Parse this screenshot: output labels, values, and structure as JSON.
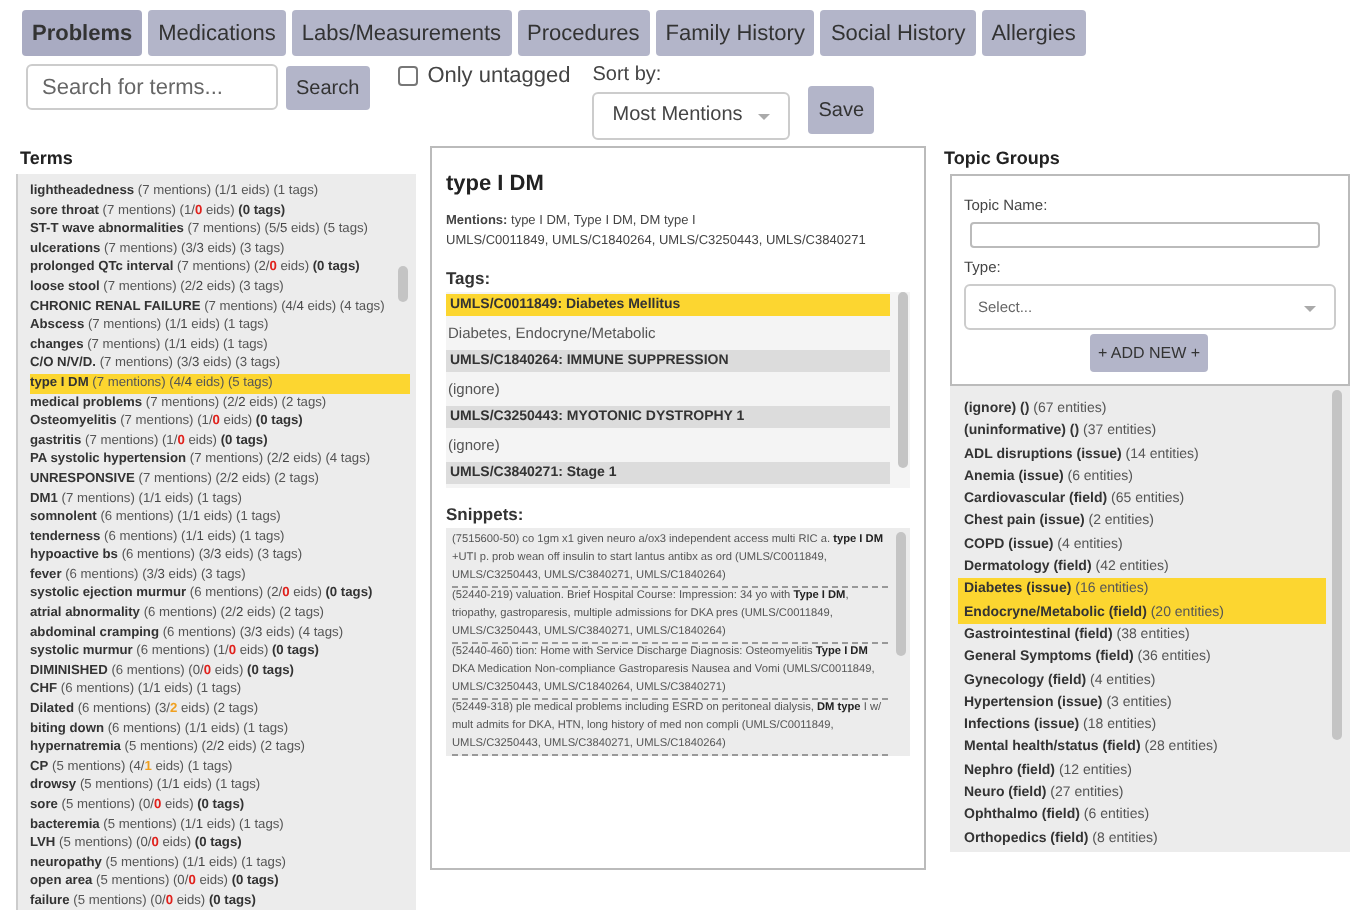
{
  "tabs": [
    {
      "label": "Problems",
      "selected": true
    },
    {
      "label": "Medications",
      "selected": false
    },
    {
      "label": "Labs/Measurements",
      "selected": false
    },
    {
      "label": "Procedures",
      "selected": false
    },
    {
      "label": "Family History",
      "selected": false
    },
    {
      "label": "Social History",
      "selected": false
    },
    {
      "label": "Allergies",
      "selected": false
    }
  ],
  "search": {
    "placeholder": "Search for terms...",
    "button": "Search"
  },
  "only_untagged": {
    "label": "Only untagged",
    "checked": false
  },
  "sort": {
    "label": "Sort by:",
    "value": "Most Mentions"
  },
  "save_button": "Save",
  "terms": {
    "heading": "Terms",
    "items": [
      {
        "name": "lightheadedness",
        "mentions": "(7 mentions)",
        "eids": [
          "(1/",
          "1",
          " eids)"
        ],
        "kind": "ok",
        "tags": "(1 tags)",
        "untagged": false,
        "selected": false
      },
      {
        "name": "sore throat",
        "mentions": "(7 mentions)",
        "eids": [
          "(1/",
          "0",
          " eids)"
        ],
        "kind": "none",
        "tags": "(0 tags)",
        "untagged": true,
        "selected": false
      },
      {
        "name": "ST-T wave abnormalities",
        "mentions": "(7 mentions)",
        "eids": [
          "(5/",
          "5",
          " eids)"
        ],
        "kind": "ok",
        "tags": "(5 tags)",
        "untagged": false,
        "selected": false
      },
      {
        "name": "ulcerations",
        "mentions": "(7 mentions)",
        "eids": [
          "(3/",
          "3",
          " eids)"
        ],
        "kind": "ok",
        "tags": "(3 tags)",
        "untagged": false,
        "selected": false
      },
      {
        "name": "prolonged QTc interval",
        "mentions": "(7 mentions)",
        "eids": [
          "(2/",
          "0",
          " eids)"
        ],
        "kind": "none",
        "tags": "(0 tags)",
        "untagged": true,
        "selected": false
      },
      {
        "name": "loose stool",
        "mentions": "(7 mentions)",
        "eids": [
          "(2/",
          "2",
          " eids)"
        ],
        "kind": "ok",
        "tags": "(3 tags)",
        "untagged": false,
        "selected": false
      },
      {
        "name": "CHRONIC RENAL FAILURE",
        "mentions": "(7 mentions)",
        "eids": [
          "(4/",
          "4",
          " eids)"
        ],
        "kind": "ok",
        "tags": "(4 tags)",
        "untagged": false,
        "selected": false
      },
      {
        "name": "Abscess",
        "mentions": "(7 mentions)",
        "eids": [
          "(1/",
          "1",
          " eids)"
        ],
        "kind": "ok",
        "tags": "(1 tags)",
        "untagged": false,
        "selected": false
      },
      {
        "name": "changes",
        "mentions": "(7 mentions)",
        "eids": [
          "(1/",
          "1",
          " eids)"
        ],
        "kind": "ok",
        "tags": "(1 tags)",
        "untagged": false,
        "selected": false
      },
      {
        "name": "C/O N/V/D.",
        "mentions": "(7 mentions)",
        "eids": [
          "(3/",
          "3",
          " eids)"
        ],
        "kind": "ok",
        "tags": "(3 tags)",
        "untagged": false,
        "selected": false
      },
      {
        "name": "type I DM",
        "mentions": "(7 mentions)",
        "eids": [
          "(4/",
          "4",
          " eids)"
        ],
        "kind": "ok",
        "tags": "(5 tags)",
        "untagged": false,
        "selected": true
      },
      {
        "name": "medical problems",
        "mentions": "(7 mentions)",
        "eids": [
          "(2/",
          "2",
          " eids)"
        ],
        "kind": "ok",
        "tags": "(2 tags)",
        "untagged": false,
        "selected": false
      },
      {
        "name": "Osteomyelitis",
        "mentions": "(7 mentions)",
        "eids": [
          "(1/",
          "0",
          " eids)"
        ],
        "kind": "none",
        "tags": "(0 tags)",
        "untagged": true,
        "selected": false
      },
      {
        "name": "gastritis",
        "mentions": "(7 mentions)",
        "eids": [
          "(1/",
          "0",
          " eids)"
        ],
        "kind": "none",
        "tags": "(0 tags)",
        "untagged": true,
        "selected": false
      },
      {
        "name": "PA systolic hypertension",
        "mentions": "(7 mentions)",
        "eids": [
          "(2/",
          "2",
          " eids)"
        ],
        "kind": "ok",
        "tags": "(4 tags)",
        "untagged": false,
        "selected": false
      },
      {
        "name": "UNRESPONSIVE",
        "mentions": "(7 mentions)",
        "eids": [
          "(2/",
          "2",
          " eids)"
        ],
        "kind": "ok",
        "tags": "(2 tags)",
        "untagged": false,
        "selected": false
      },
      {
        "name": "DM1",
        "mentions": "(7 mentions)",
        "eids": [
          "(1/",
          "1",
          " eids)"
        ],
        "kind": "ok",
        "tags": "(1 tags)",
        "untagged": false,
        "selected": false
      },
      {
        "name": "somnolent",
        "mentions": "(6 mentions)",
        "eids": [
          "(1/",
          "1",
          " eids)"
        ],
        "kind": "ok",
        "tags": "(1 tags)",
        "untagged": false,
        "selected": false
      },
      {
        "name": "tenderness",
        "mentions": "(6 mentions)",
        "eids": [
          "(1/",
          "1",
          " eids)"
        ],
        "kind": "ok",
        "tags": "(1 tags)",
        "untagged": false,
        "selected": false
      },
      {
        "name": "hypoactive bs",
        "mentions": "(6 mentions)",
        "eids": [
          "(3/",
          "3",
          " eids)"
        ],
        "kind": "ok",
        "tags": "(3 tags)",
        "untagged": false,
        "selected": false
      },
      {
        "name": "fever",
        "mentions": "(6 mentions)",
        "eids": [
          "(3/",
          "3",
          " eids)"
        ],
        "kind": "ok",
        "tags": "(3 tags)",
        "untagged": false,
        "selected": false
      },
      {
        "name": "systolic ejection murmur",
        "mentions": "(6 mentions)",
        "eids": [
          "(2/",
          "0",
          " eids)"
        ],
        "kind": "none",
        "tags": "(0 tags)",
        "untagged": true,
        "selected": false
      },
      {
        "name": "atrial abnormality",
        "mentions": "(6 mentions)",
        "eids": [
          "(2/",
          "2",
          " eids)"
        ],
        "kind": "ok",
        "tags": "(2 tags)",
        "untagged": false,
        "selected": false
      },
      {
        "name": "abdominal cramping",
        "mentions": "(6 mentions)",
        "eids": [
          "(3/",
          "3",
          " eids)"
        ],
        "kind": "ok",
        "tags": "(4 tags)",
        "untagged": false,
        "selected": false
      },
      {
        "name": "systolic murmur",
        "mentions": "(6 mentions)",
        "eids": [
          "(1/",
          "0",
          " eids)"
        ],
        "kind": "none",
        "tags": "(0 tags)",
        "untagged": true,
        "selected": false
      },
      {
        "name": "DIMINISHED",
        "mentions": "(6 mentions)",
        "eids": [
          "(0/",
          "0",
          " eids)"
        ],
        "kind": "none",
        "tags": "(0 tags)",
        "untagged": true,
        "selected": false
      },
      {
        "name": "CHF",
        "mentions": "(6 mentions)",
        "eids": [
          "(1/",
          "1",
          " eids)"
        ],
        "kind": "ok",
        "tags": "(1 tags)",
        "untagged": false,
        "selected": false
      },
      {
        "name": "Dilated",
        "mentions": "(6 mentions)",
        "eids": [
          "(3/",
          "2",
          " eids)"
        ],
        "kind": "partial",
        "tags": "(2 tags)",
        "untagged": false,
        "selected": false
      },
      {
        "name": "biting down",
        "mentions": "(6 mentions)",
        "eids": [
          "(1/",
          "1",
          " eids)"
        ],
        "kind": "ok",
        "tags": "(1 tags)",
        "untagged": false,
        "selected": false
      },
      {
        "name": "hypernatremia",
        "mentions": "(5 mentions)",
        "eids": [
          "(2/",
          "2",
          " eids)"
        ],
        "kind": "ok",
        "tags": "(2 tags)",
        "untagged": false,
        "selected": false
      },
      {
        "name": "CP",
        "mentions": "(5 mentions)",
        "eids": [
          "(4/",
          "1",
          " eids)"
        ],
        "kind": "partial",
        "tags": "(1 tags)",
        "untagged": false,
        "selected": false
      },
      {
        "name": "drowsy",
        "mentions": "(5 mentions)",
        "eids": [
          "(1/",
          "1",
          " eids)"
        ],
        "kind": "ok",
        "tags": "(1 tags)",
        "untagged": false,
        "selected": false
      },
      {
        "name": "sore",
        "mentions": "(5 mentions)",
        "eids": [
          "(0/",
          "0",
          " eids)"
        ],
        "kind": "none",
        "tags": "(0 tags)",
        "untagged": true,
        "selected": false
      },
      {
        "name": "bacteremia",
        "mentions": "(5 mentions)",
        "eids": [
          "(1/",
          "1",
          " eids)"
        ],
        "kind": "ok",
        "tags": "(1 tags)",
        "untagged": false,
        "selected": false
      },
      {
        "name": "LVH",
        "mentions": "(5 mentions)",
        "eids": [
          "(0/",
          "0",
          " eids)"
        ],
        "kind": "none",
        "tags": "(0 tags)",
        "untagged": true,
        "selected": false
      },
      {
        "name": "neuropathy",
        "mentions": "(5 mentions)",
        "eids": [
          "(1/",
          "1",
          " eids)"
        ],
        "kind": "ok",
        "tags": "(1 tags)",
        "untagged": false,
        "selected": false
      },
      {
        "name": "open area",
        "mentions": "(5 mentions)",
        "eids": [
          "(0/",
          "0",
          " eids)"
        ],
        "kind": "none",
        "tags": "(0 tags)",
        "untagged": true,
        "selected": false
      },
      {
        "name": "failure",
        "mentions": "(5 mentions)",
        "eids": [
          "(0/",
          "0",
          " eids)"
        ],
        "kind": "none",
        "tags": "(0 tags)",
        "untagged": true,
        "selected": false
      }
    ]
  },
  "detail": {
    "title": "type I DM",
    "mentions_label": "Mentions:",
    "mentions": "type I DM, Type I DM, DM type I",
    "codes": "UMLS/C0011849, UMLS/C1840264, UMLS/C3250443, UMLS/C3840271",
    "tags_heading": "Tags:",
    "tags": [
      {
        "concept": "UMLS/C0011849: Diabetes Mellitus",
        "groups": "Diabetes, Endocryne/Metabolic",
        "selected": true
      },
      {
        "concept": "UMLS/C1840264: IMMUNE SUPPRESSION",
        "groups": "(ignore)",
        "selected": false
      },
      {
        "concept": "UMLS/C3250443: MYOTONIC DYSTROPHY 1",
        "groups": "(ignore)",
        "selected": false
      },
      {
        "concept": "UMLS/C3840271: Stage 1",
        "selected": false
      }
    ],
    "snippets_heading": "Snippets:",
    "snippets": [
      "(7515600-50) co 1gm x1 given neuro a/ox3 independent access multi RIC a. **type I DM** +UTI p. prob wean off insulin to start lantus antibx as ord (UMLS/C0011849, UMLS/C3250443, UMLS/C3840271, UMLS/C1840264)",
      "(52440-219) valuation. Brief Hospital Course: Impression: 34 yo with **Type I DM**, triopathy, gastroparesis, multiple admissions for DKA pres (UMLS/C0011849, UMLS/C3250443, UMLS/C3840271, UMLS/C1840264)",
      "(52440-460) tion: Home with Service Discharge Diagnosis: Osteomyelitis **Type I DM** DKA Medication Non-compliance Gastroparesis Nausea and Vomi (UMLS/C0011849, UMLS/C3250443, UMLS/C1840264, UMLS/C3840271)",
      "(52449-318) ple medical problems including ESRD on peritoneal dialysis, **DM type** I w/ mult admits for DKA, HTN, long history of med non compli (UMLS/C0011849, UMLS/C3250443, UMLS/C3840271, UMLS/C1840264)"
    ]
  },
  "topics": {
    "heading": "Topic Groups",
    "name_label": "Topic Name:",
    "type_label": "Type:",
    "type_placeholder": "Select...",
    "add_button": "+ ADD NEW +",
    "items": [
      {
        "name": "(ignore) ()",
        "count": "(67 entities)",
        "selected": false
      },
      {
        "name": "(uninformative) ()",
        "count": "(37 entities)",
        "selected": false
      },
      {
        "name": "ADL disruptions (issue)",
        "count": "(14 entities)",
        "selected": false
      },
      {
        "name": "Anemia (issue)",
        "count": "(6 entities)",
        "selected": false
      },
      {
        "name": "Cardiovascular (field)",
        "count": "(65 entities)",
        "selected": false
      },
      {
        "name": "Chest pain (issue)",
        "count": "(2 entities)",
        "selected": false
      },
      {
        "name": "COPD (issue)",
        "count": "(4 entities)",
        "selected": false
      },
      {
        "name": "Dermatology (field)",
        "count": "(42 entities)",
        "selected": false
      },
      {
        "name": "Diabetes (issue)",
        "count": "(16 entities)",
        "selected": true
      },
      {
        "name": "Endocryne/Metabolic (field)",
        "count": "(20 entities)",
        "selected": true
      },
      {
        "name": "Gastrointestinal (field)",
        "count": "(38 entities)",
        "selected": false
      },
      {
        "name": "General Symptoms (field)",
        "count": "(36 entities)",
        "selected": false
      },
      {
        "name": "Gynecology (field)",
        "count": "(4 entities)",
        "selected": false
      },
      {
        "name": "Hypertension (issue)",
        "count": "(3 entities)",
        "selected": false
      },
      {
        "name": "Infections (issue)",
        "count": "(18 entities)",
        "selected": false
      },
      {
        "name": "Mental health/status (field)",
        "count": "(28 entities)",
        "selected": false
      },
      {
        "name": "Nephro (field)",
        "count": "(12 entities)",
        "selected": false
      },
      {
        "name": "Neuro (field)",
        "count": "(27 entities)",
        "selected": false
      },
      {
        "name": "Ophthalmo (field)",
        "count": "(6 entities)",
        "selected": false
      },
      {
        "name": "Orthopedics (field)",
        "count": "(8 entities)",
        "selected": false
      }
    ]
  }
}
